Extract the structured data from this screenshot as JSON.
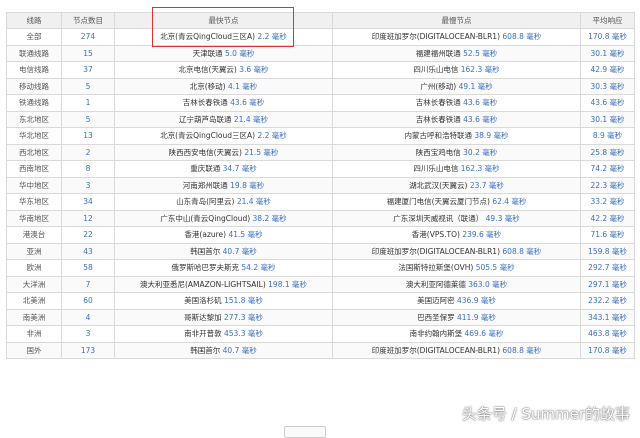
{
  "headers": {
    "line": "线路",
    "count": "节点数目",
    "fastest": "最快节点",
    "slowest": "最慢节点",
    "avg": "平均响应"
  },
  "rows": [
    {
      "line": "全部",
      "count": "274",
      "fast_node": "北京(青云QingCloud三区A)",
      "fast_val": "2.2 毫秒",
      "slow_node": "印度班加罗尔(DIGITALOCEAN-BLR1)",
      "slow_val": "608.8 毫秒",
      "avg": "170.8 毫秒"
    },
    {
      "line": "联通线路",
      "count": "15",
      "fast_node": "天津联通",
      "fast_val": "5.0 毫秒",
      "slow_node": "福建福州联通",
      "slow_val": "52.5 毫秒",
      "avg": "30.1 毫秒"
    },
    {
      "line": "电信线路",
      "count": "37",
      "fast_node": "北京电信(天翼云)",
      "fast_val": "3.6 毫秒",
      "slow_node": "四川乐山电信",
      "slow_val": "162.3 毫秒",
      "avg": "42.9 毫秒"
    },
    {
      "line": "移动线路",
      "count": "5",
      "fast_node": "北京(移动)",
      "fast_val": "4.1 毫秒",
      "slow_node": "广州(移动)",
      "slow_val": "49.1 毫秒",
      "avg": "30.3 毫秒"
    },
    {
      "line": "铁通线路",
      "count": "1",
      "fast_node": "吉林长春铁通",
      "fast_val": "43.6 毫秒",
      "slow_node": "吉林长春铁通",
      "slow_val": "43.6 毫秒",
      "avg": "43.6 毫秒"
    },
    {
      "line": "东北地区",
      "count": "5",
      "fast_node": "辽宁葫芦岛联通",
      "fast_val": "21.4 毫秒",
      "slow_node": "吉林长春铁通",
      "slow_val": "43.6 毫秒",
      "avg": "30.1 毫秒"
    },
    {
      "line": "华北地区",
      "count": "13",
      "fast_node": "北京(青云QingCloud三区A)",
      "fast_val": "2.2 毫秒",
      "slow_node": "内蒙古呼和浩特联通",
      "slow_val": "38.9 毫秒",
      "avg": "8.9 毫秒"
    },
    {
      "line": "西北地区",
      "count": "2",
      "fast_node": "陕西西安电信(天翼云)",
      "fast_val": "21.5 毫秒",
      "slow_node": "陕西宝鸡电信",
      "slow_val": "30.2 毫秒",
      "avg": "25.8 毫秒"
    },
    {
      "line": "西南地区",
      "count": "8",
      "fast_node": "重庆联通",
      "fast_val": "34.7 毫秒",
      "slow_node": "四川乐山电信",
      "slow_val": "162.3 毫秒",
      "avg": "74.2 毫秒"
    },
    {
      "line": "华中地区",
      "count": "3",
      "fast_node": "河南郑州联通",
      "fast_val": "19.8 毫秒",
      "slow_node": "湖北武汉(天翼云)",
      "slow_val": "23.7 毫秒",
      "avg": "22.3 毫秒"
    },
    {
      "line": "华东地区",
      "count": "34",
      "fast_node": "山东青岛(阿里云)",
      "fast_val": "21.4 毫秒",
      "slow_node": "福建厦门电信(天翼云厦门节点)",
      "slow_val": "62.4 毫秒",
      "avg": "33.2 毫秒"
    },
    {
      "line": "华南地区",
      "count": "12",
      "fast_node": "广东中山(青云QingCloud)",
      "fast_val": "38.2 毫秒",
      "slow_node": "广东深圳天威视讯（联通）",
      "slow_val": "49.3 毫秒",
      "avg": "42.2 毫秒"
    },
    {
      "line": "港澳台",
      "count": "22",
      "fast_node": "香港(azure)",
      "fast_val": "41.5 毫秒",
      "slow_node": "香港(VPS.TO)",
      "slow_val": "239.6 毫秒",
      "avg": "71.6 毫秒"
    },
    {
      "line": "亚洲",
      "count": "43",
      "fast_node": "韩国首尔",
      "fast_val": "40.7 毫秒",
      "slow_node": "印度班加罗尔(DIGITALOCEAN-BLR1)",
      "slow_val": "608.8 毫秒",
      "avg": "159.8 毫秒"
    },
    {
      "line": "欧洲",
      "count": "58",
      "fast_node": "俄罗斯哈巴罗夫斯克",
      "fast_val": "54.2 毫秒",
      "slow_node": "法国斯特拉斯堡(OVH)",
      "slow_val": "505.5 毫秒",
      "avg": "292.7 毫秒"
    },
    {
      "line": "大洋洲",
      "count": "7",
      "fast_node": "澳大利亚悉尼(AMAZON-LIGHTSAIL)",
      "fast_val": "198.1 毫秒",
      "slow_node": "澳大利亚阿德莱德",
      "slow_val": "363.0 毫秒",
      "avg": "297.1 毫秒"
    },
    {
      "line": "北美洲",
      "count": "60",
      "fast_node": "美国洛杉矶",
      "fast_val": "151.8 毫秒",
      "slow_node": "美国迈阿密",
      "slow_val": "436.9 毫秒",
      "avg": "232.2 毫秒"
    },
    {
      "line": "南美洲",
      "count": "4",
      "fast_node": "哥斯达黎加",
      "fast_val": "277.3 毫秒",
      "slow_node": "巴西圣保罗",
      "slow_val": "411.9 毫秒",
      "avg": "343.1 毫秒"
    },
    {
      "line": "非洲",
      "count": "3",
      "fast_node": "南非开普敦",
      "fast_val": "453.3 毫秒",
      "slow_node": "南非约翰内斯堡",
      "slow_val": "469.6 毫秒",
      "avg": "463.8 毫秒"
    },
    {
      "line": "国外",
      "count": "173",
      "fast_node": "韩国首尔",
      "fast_val": "40.7 毫秒",
      "slow_node": "印度班加罗尔(DIGITALOCEAN-BLR1)",
      "slow_val": "608.8 毫秒",
      "avg": "170.8 毫秒"
    }
  ],
  "watermark": "头条号 / Summer的故事",
  "colors": {
    "link": "#3b6fc4",
    "highlight_box": "#e0312f",
    "header_bg": "#f0f0f0",
    "border": "#d9d9d9"
  }
}
